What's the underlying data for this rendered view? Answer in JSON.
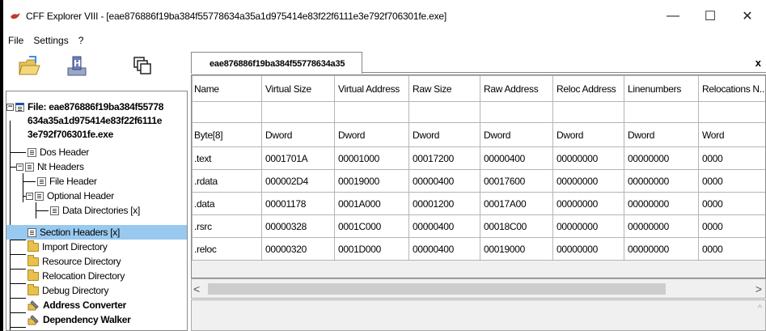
{
  "window": {
    "title": "CFF Explorer VIII - [eae876886f19ba384f55778634a35a1d975414e83f22f6111e3e792f706301fe.exe]",
    "minimize": "—",
    "maximize": "☐",
    "close": "✕"
  },
  "menu": [
    "File",
    "Settings",
    "?"
  ],
  "toolbar": {
    "icons": [
      "open-folder-icon",
      "save-disk-icon",
      "windows-icon"
    ]
  },
  "tree": {
    "root_line1": "File: eae876886f19ba384f55778",
    "root_line2": "634a35a1d975414e83f22f6111e",
    "root_line3": "3e792f706301fe.exe",
    "items": [
      {
        "label": "Dos Header"
      },
      {
        "label": "Nt Headers"
      },
      {
        "label": "File Header"
      },
      {
        "label": "Optional Header"
      },
      {
        "label": "Data Directories [x]"
      },
      {
        "label": "Section Headers [x]"
      },
      {
        "label": "Import Directory"
      },
      {
        "label": "Resource Directory"
      },
      {
        "label": "Relocation Directory"
      },
      {
        "label": "Debug Directory"
      },
      {
        "label": "Address Converter"
      },
      {
        "label": "Dependency Walker"
      }
    ]
  },
  "tab": {
    "label": "eae876886f19ba384f55778634a35",
    "close": "x"
  },
  "table": {
    "headers": [
      "Name",
      "Virtual Size",
      "Virtual Address",
      "Raw Size",
      "Raw Address",
      "Reloc Address",
      "Linenumbers",
      "Relocations N..."
    ],
    "types": [
      "Byte[8]",
      "Dword",
      "Dword",
      "Dword",
      "Dword",
      "Dword",
      "Dword",
      "Word"
    ],
    "rows": [
      [
        ".text",
        "0001701A",
        "00001000",
        "00017200",
        "00000400",
        "00000000",
        "00000000",
        "0000"
      ],
      [
        ".rdata",
        "000002D4",
        "00019000",
        "00000400",
        "00017600",
        "00000000",
        "00000000",
        "0000"
      ],
      [
        ".data",
        "00001178",
        "0001A000",
        "00001200",
        "00017A00",
        "00000000",
        "00000000",
        "0000"
      ],
      [
        ".rsrc",
        "00000328",
        "0001C000",
        "00000400",
        "00018C00",
        "00000000",
        "00000000",
        "0000"
      ],
      [
        ".reloc",
        "00000320",
        "0001D000",
        "00000400",
        "00019000",
        "00000000",
        "00000000",
        "0000"
      ]
    ]
  },
  "scroll": {
    "left": "<",
    "right": ">",
    "up": "^"
  }
}
